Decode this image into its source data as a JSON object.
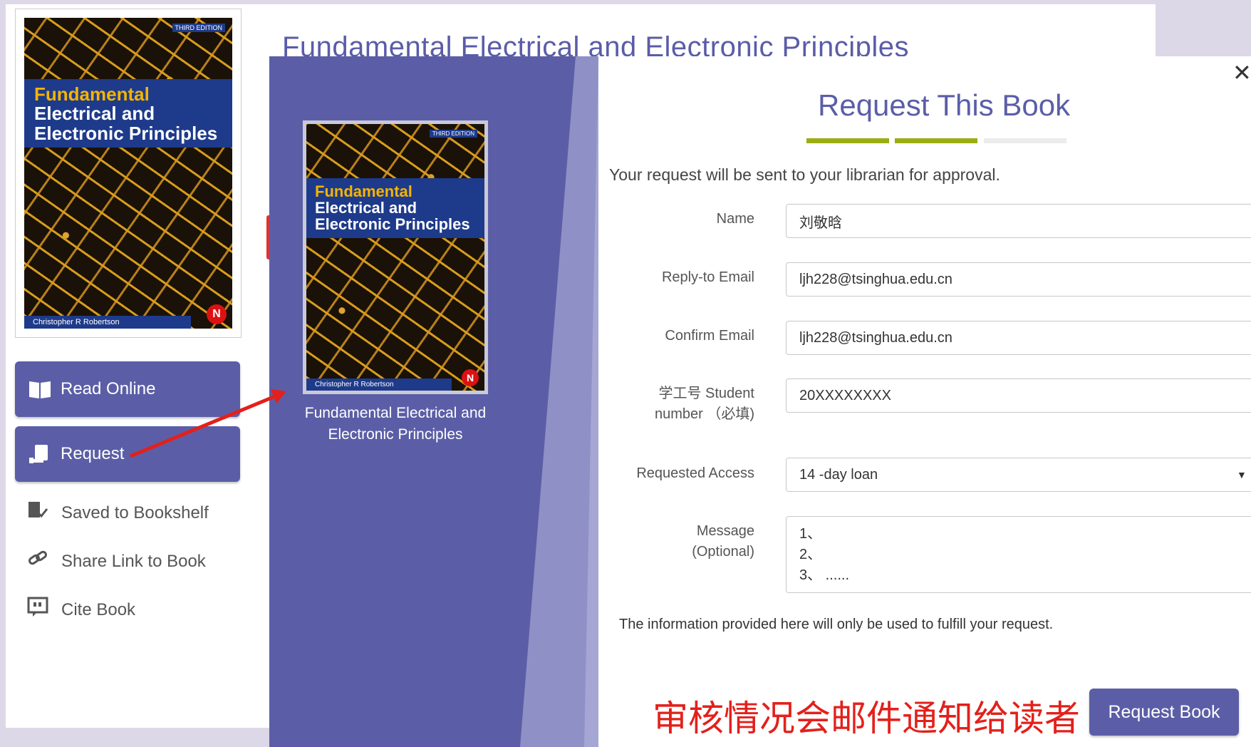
{
  "background_page": {
    "book_title": "Fundamental Electrical and Electronic Principles",
    "cover": {
      "edition": "THIRD EDITION",
      "title_lines": [
        "Fundamental",
        "Electrical and",
        "Electronic Principles"
      ],
      "author": "Christopher R Robertson",
      "publisher_mark": "N"
    },
    "actions": {
      "read_online": "Read Online",
      "request": "Request",
      "saved": "Saved to Bookshelf",
      "share": "Share Link to Book",
      "cite": "Cite Book"
    }
  },
  "modal": {
    "book_title": "Fundamental Electrical and Electronic Principles",
    "title": "Request This Book",
    "steps": [
      {
        "state": "done",
        "color": "#9aad12"
      },
      {
        "state": "done",
        "color": "#9aad12"
      },
      {
        "state": "pending",
        "color": "#ececec"
      }
    ],
    "intro": "Your request will be sent to your librarian for approval.",
    "fields": {
      "name": {
        "label": "Name",
        "value": "刘敬晗"
      },
      "reply_email": {
        "label": "Reply-to Email",
        "value": "ljh228@tsinghua.edu.cn"
      },
      "confirm_email": {
        "label": "Confirm Email",
        "value": "ljh228@tsinghua.edu.cn"
      },
      "student_number": {
        "label_line1": "学工号 Student",
        "label_line2": "number （必填)",
        "value": "20XXXXXXXX"
      },
      "requested_access": {
        "label": "Requested Access",
        "value": "14 -day loan"
      },
      "message": {
        "label_line1": "Message",
        "label_line2": "(Optional)",
        "lines": [
          "1、",
          "2、",
          "3、 ......"
        ]
      }
    },
    "info_note": "The information provided here will only be used to fulfill your request.",
    "submit_label": "Request Book",
    "annotation": "审核情况会邮件通知给读者"
  },
  "colors": {
    "accent": "#5b5ea6",
    "step_done": "#9aad12",
    "annotation_red": "#e3201b"
  }
}
